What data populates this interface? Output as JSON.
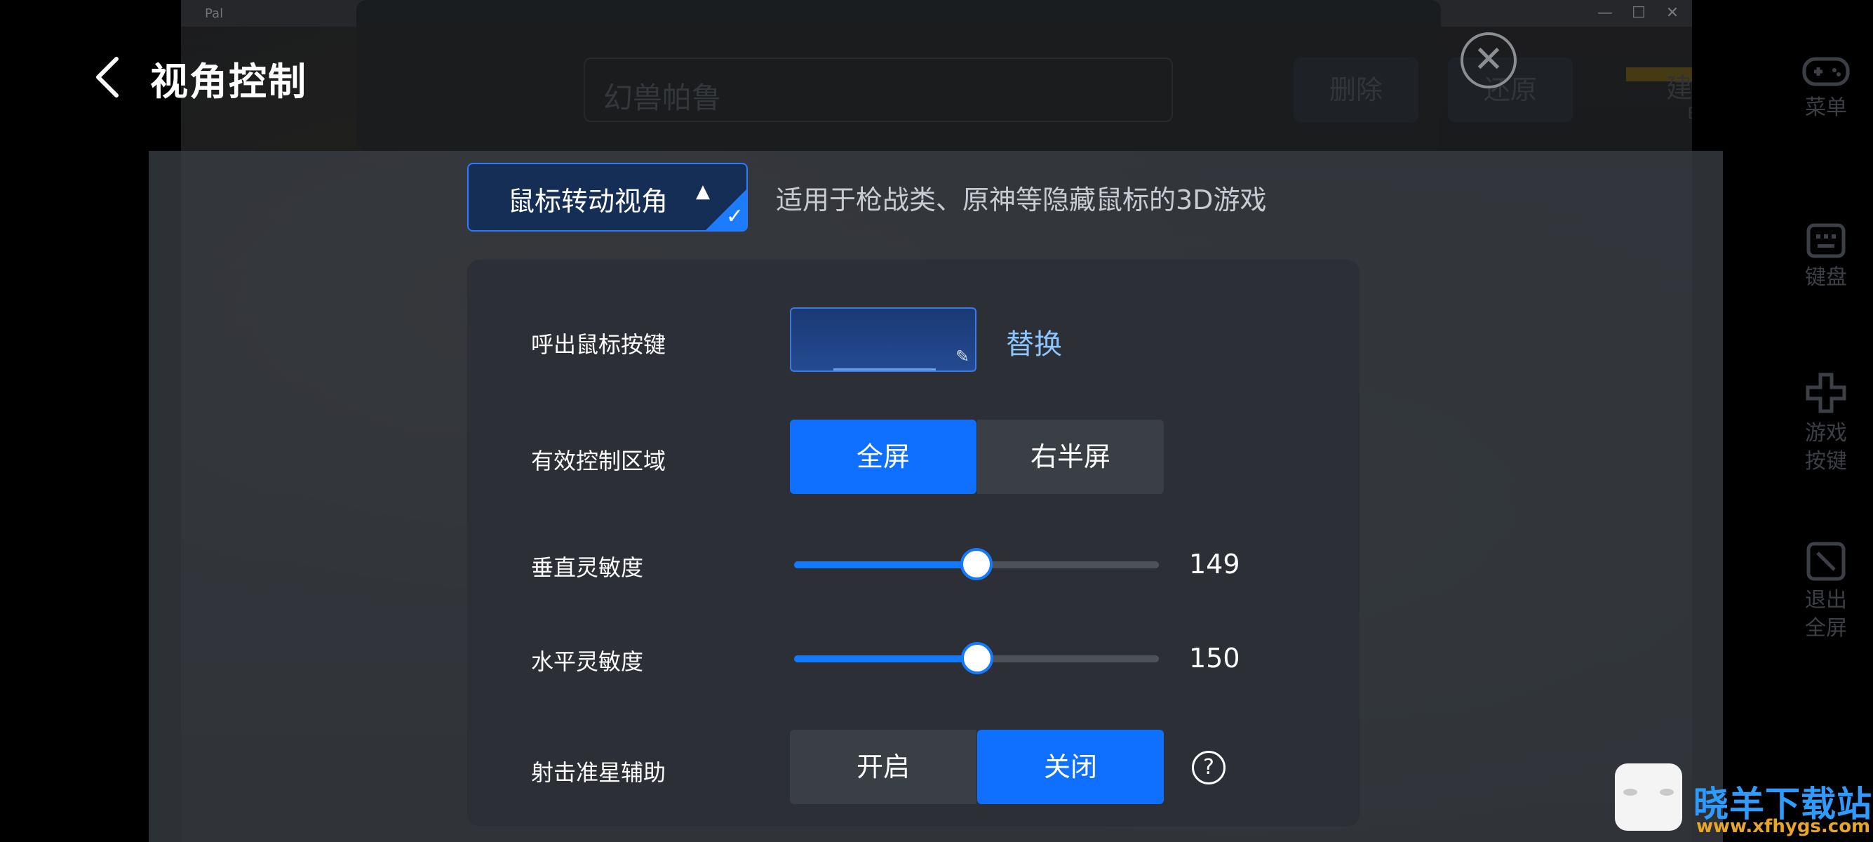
{
  "background": {
    "app_name": "Pal",
    "window_controls": [
      "—",
      "☐",
      "✕"
    ],
    "editor": {
      "name_value": "幻兽帕鲁",
      "delete_label": "删除",
      "restore_label": "还原"
    },
    "build_label": "建造",
    "build_key": "B"
  },
  "sidebar": [
    {
      "label": "菜单",
      "icon": "gamepad-icon"
    },
    {
      "label": "键盘",
      "icon": "keyboard-icon"
    },
    {
      "label": "游戏\n按键",
      "icon": "dpad-icon"
    },
    {
      "label": "退出\n全屏",
      "icon": "exit-fullscreen-icon"
    }
  ],
  "header": {
    "title": "视角控制",
    "back_icon": "chevron-left-icon"
  },
  "mode": {
    "selected": "鼠标转动视角",
    "description": "适用于枪战类、原神等隐藏鼠标的3D游戏"
  },
  "settings": {
    "hotkey": {
      "label": "呼出鼠标按键",
      "value": "",
      "replace_label": "替换"
    },
    "area": {
      "label": "有效控制区域",
      "options": [
        "全屏",
        "右半屏"
      ],
      "selected": "全屏"
    },
    "vertical": {
      "label": "垂直灵敏度",
      "value": 149,
      "fraction": 0.5
    },
    "horizontal": {
      "label": "水平灵敏度",
      "value": 150,
      "fraction": 0.502
    },
    "aim_assist": {
      "label": "射击准星辅助",
      "options": [
        "开启",
        "关闭"
      ],
      "selected": "关闭",
      "help_icon": "question-circle-icon"
    }
  },
  "watermark": {
    "title": "晓羊下载站",
    "url": "www.xfhygs.com"
  },
  "colors": {
    "accent": "#0f6fff",
    "link": "#8cc6ff"
  }
}
